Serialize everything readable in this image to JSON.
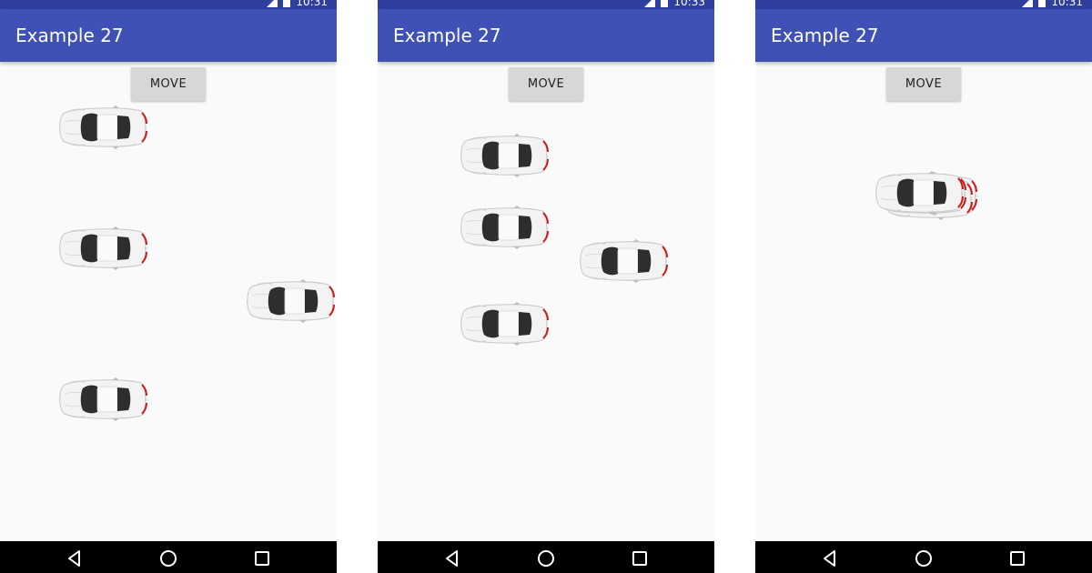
{
  "screens": [
    {
      "status_time": "10:31",
      "title": "Example 27",
      "button_label": "MOVE",
      "car_icon": "white-sports-car-top-view"
    },
    {
      "status_time": "10:33",
      "title": "Example 27",
      "button_label": "MOVE",
      "car_icon": "white-sports-car-top-view"
    },
    {
      "status_time": "10:31",
      "title": "Example 27",
      "button_label": "MOVE",
      "car_icon": "white-sports-car-top-view"
    }
  ],
  "nav_icons": [
    "back-icon",
    "home-icon",
    "recents-icon"
  ],
  "colors": {
    "status_bar": "#303f9f",
    "app_bar": "#3f51b5",
    "background": "#fafafa",
    "button": "#d6d7d7",
    "nav_bar": "#000000",
    "car_body": "#f2f2f2",
    "car_glass": "#2f2f2f",
    "car_taillight": "#cc1b1b"
  }
}
